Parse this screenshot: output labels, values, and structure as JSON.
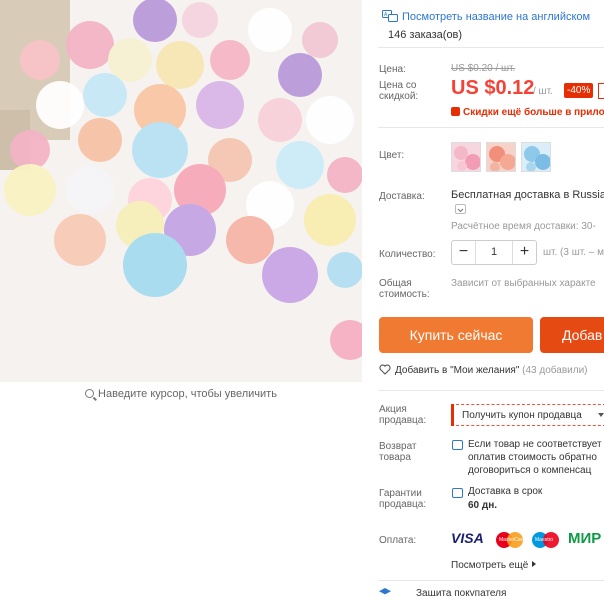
{
  "gallery": {
    "zoom_hint": "Наведите курсор, чтобы увеличить"
  },
  "header": {
    "translate_link": "Посмотреть название на английском",
    "orders": "146 заказа(ов)"
  },
  "price": {
    "label": "Цена:",
    "discount_label": "Цена со скидкой:",
    "old": "US $0.20 / шт.",
    "current": "US $0.12",
    "per": "/ шт.",
    "discount": "-40%",
    "promo": "Скидки ещё больше в прило"
  },
  "color": {
    "label": "Цвет:",
    "swatch_colors": [
      "#f3b9c9",
      "#f28f7a",
      "#8ec9ea"
    ]
  },
  "shipping": {
    "label": "Доставка:",
    "value": "Бесплатная доставка в Russian",
    "estimate": "Расчётное время доставки: 30-"
  },
  "quantity": {
    "label": "Количество:",
    "value": "1",
    "minus": "−",
    "plus": "+",
    "note": "шт. (3 шт. – м"
  },
  "total": {
    "label": "Общая стоимость:",
    "value": "Зависит от выбранных характе"
  },
  "buttons": {
    "buy": "Купить сейчас",
    "add": "Добав"
  },
  "wishlist": {
    "label": "Добавить в \"Мои желания\"",
    "count": "(43 добавили)"
  },
  "seller_promo": {
    "label": "Акция продавца:",
    "coupon": "Получить купон продавца"
  },
  "returns": {
    "label": "Возврат товара",
    "lines": [
      "Если товар не соответствует",
      "оплатив стоимость обратно",
      "договориться о компенсац"
    ]
  },
  "guarantee": {
    "label": "Гарантии продавца:",
    "delivery": "Доставка в срок",
    "days": "60 дн."
  },
  "payment": {
    "label": "Оплата:",
    "visa": "VISA",
    "mc": "MasterCard",
    "maestro": "Maestro",
    "mir": "МИР",
    "more": "Посмотреть ещё"
  },
  "bottom": {
    "text": "Защита покупателя"
  },
  "colors": {
    "accent_red": "#e62e04",
    "buy_orange": "#f07a32",
    "add_orange": "#e64a13",
    "link_blue": "#2e76cf"
  }
}
